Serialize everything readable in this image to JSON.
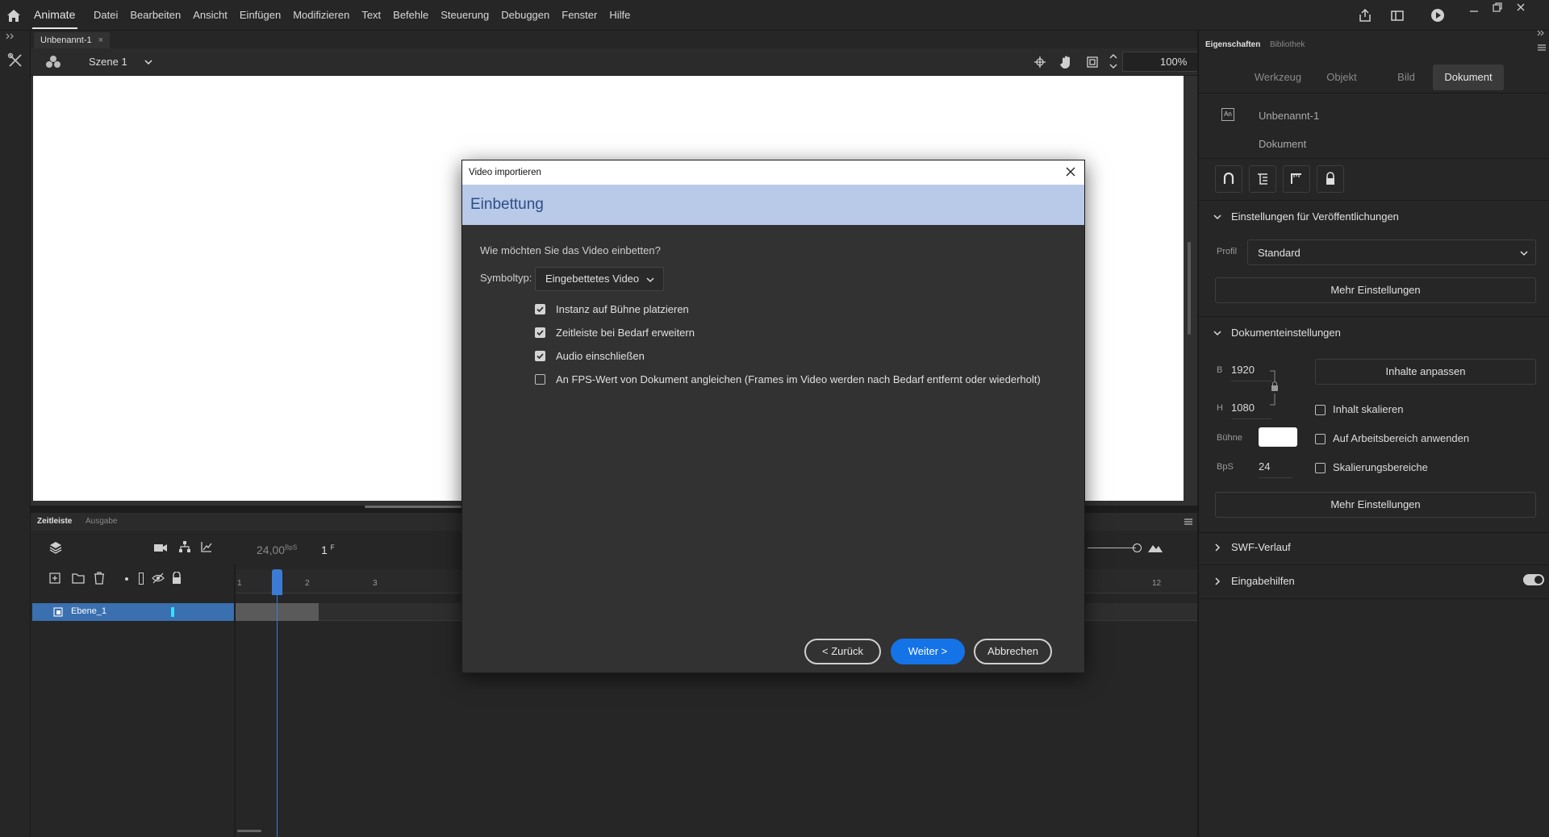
{
  "app": {
    "name": "Animate"
  },
  "menu": [
    "Datei",
    "Bearbeiten",
    "Ansicht",
    "Einfügen",
    "Modifizieren",
    "Text",
    "Befehle",
    "Steuerung",
    "Debuggen",
    "Fenster",
    "Hilfe"
  ],
  "document": {
    "tab_title": "Unbenannt-1",
    "tab_close": "×",
    "scene": "Szene 1",
    "zoom": "100%"
  },
  "timeline": {
    "tabs": [
      "Zeitleiste",
      "Ausgabe"
    ],
    "fps": "24,00",
    "fps_unit": "BpS",
    "current_frame": "1",
    "frame_unit": "F",
    "ruler": [
      "1",
      "2",
      "3",
      "12"
    ],
    "layer_name": "Ebene_1"
  },
  "properties": {
    "tabs": [
      "Eigenschaften",
      "Bibliothek"
    ],
    "segments": [
      "Werkzeug",
      "Objekt",
      "Bild",
      "Dokument"
    ],
    "doc_name": "Unbenannt-1",
    "doc_type": "Dokument",
    "publish_section": "Einstellungen für Veröffentlichungen",
    "profile_label": "Profil",
    "profile_value": "Standard",
    "more_settings": "Mehr Einstellungen",
    "doc_settings_section": "Dokumenteinstellungen",
    "width_label": "B",
    "width_value": "1920",
    "height_label": "H",
    "height_value": "1080",
    "fit_content": "Inhalte anpassen",
    "scale_content": "Inhalt skalieren",
    "apply_workspace": "Auf Arbeitsbereich anwenden",
    "scale_regions": "Skalierungsbereiche",
    "stage_label": "Bühne",
    "stage_color": "#ffffff",
    "fps_label": "BpS",
    "fps_value": "24",
    "swf_history": "SWF-Verlauf",
    "accessibility": "Eingabehilfen"
  },
  "dialog": {
    "title": "Video importieren",
    "heading": "Einbettung",
    "question": "Wie möchten Sie das Video einbetten?",
    "symbol_label": "Symboltyp:",
    "symbol_value": "Eingebettetes Video",
    "options": [
      {
        "label": "Instanz auf Bühne platzieren",
        "checked": true
      },
      {
        "label": "Zeitleiste bei Bedarf erweitern",
        "checked": true
      },
      {
        "label": "Audio einschließen",
        "checked": true
      },
      {
        "label": "An FPS-Wert von Dokument angleichen (Frames im Video werden nach Bedarf entfernt oder wiederholt)",
        "checked": false
      }
    ],
    "back": "< Zurück",
    "next": "Weiter >",
    "cancel": "Abbrechen"
  },
  "colors": {
    "accent": "#1473e6",
    "banner": "#b9c9e8",
    "layer_selected": "#3a6fb0",
    "playhead": "#3a7bd5"
  }
}
